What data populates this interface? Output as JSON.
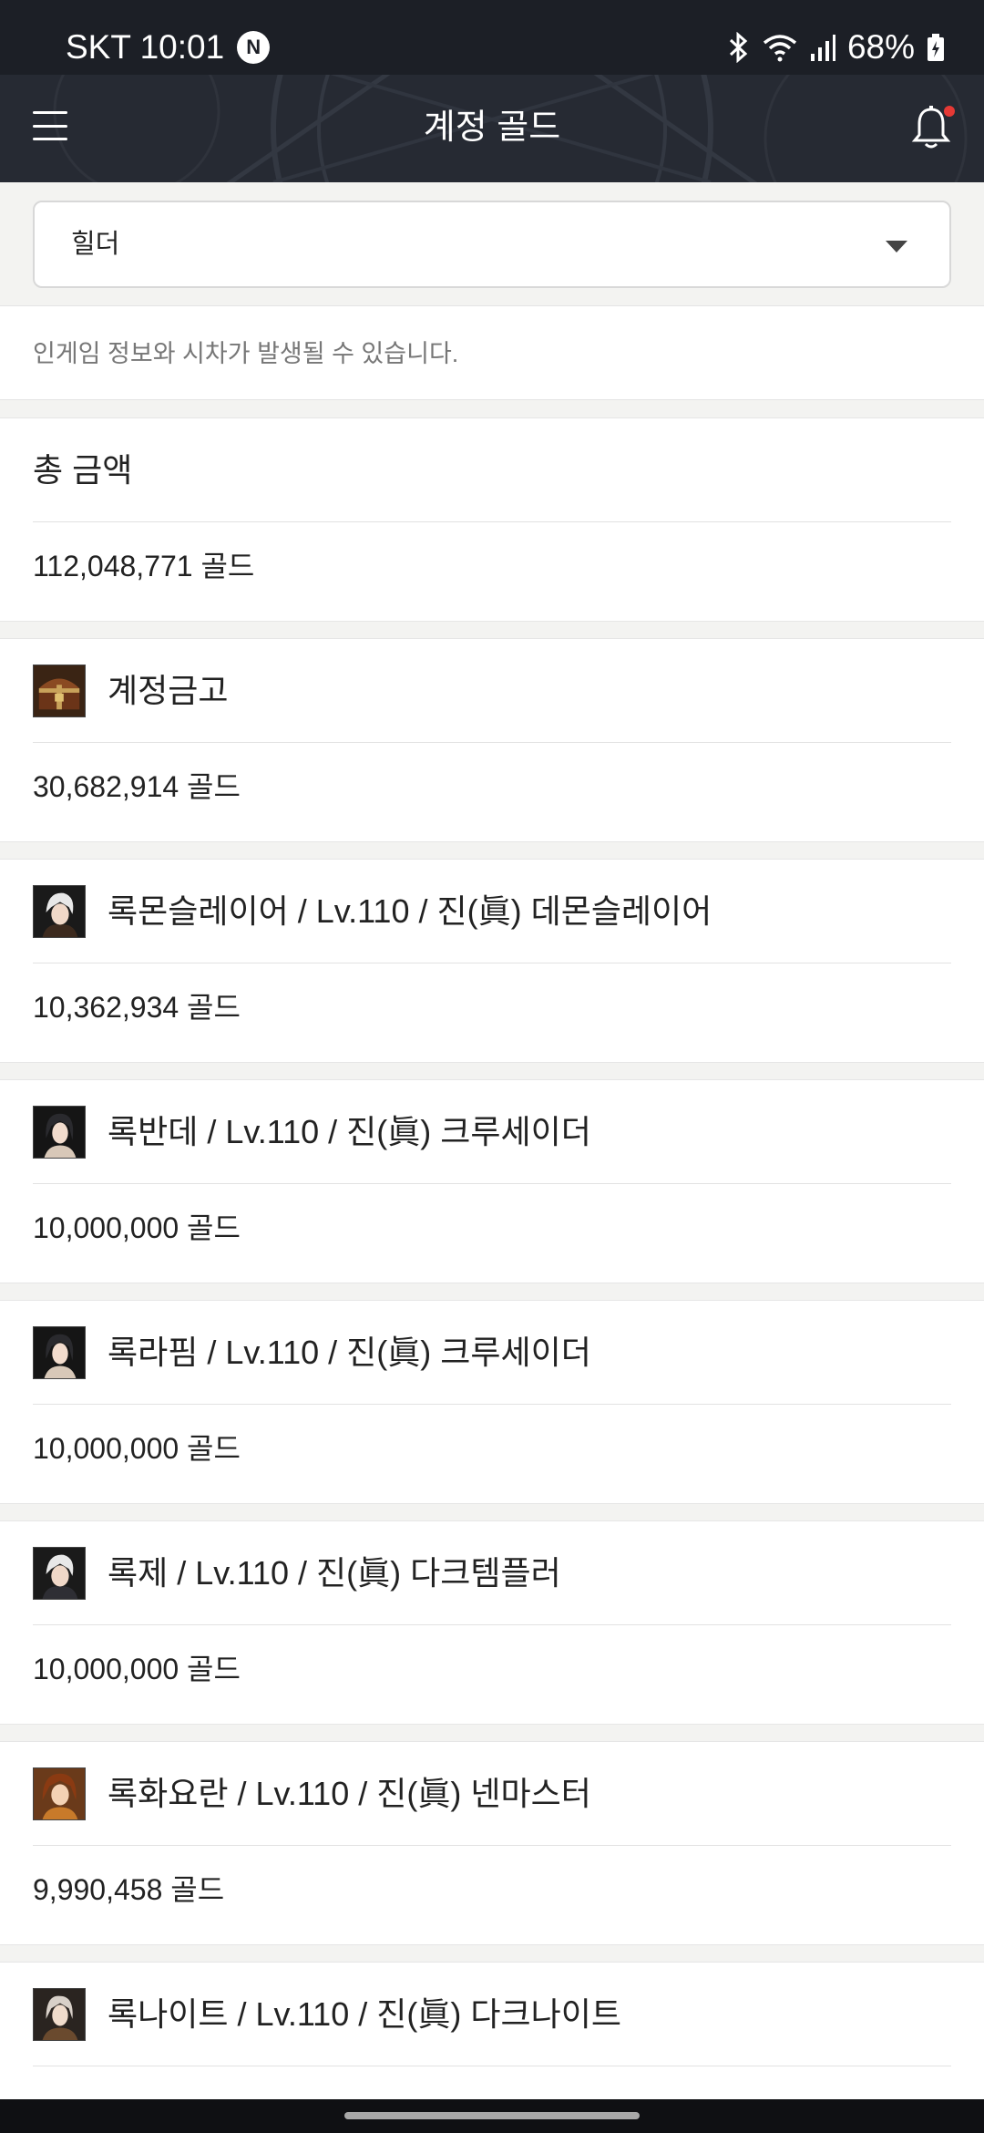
{
  "status_bar": {
    "carrier_time": "SKT 10:01",
    "n_badge": "N",
    "battery": "68%"
  },
  "header": {
    "title": "계정 골드",
    "menu_icon": "hamburger-icon",
    "bell_icon": "bell-icon"
  },
  "selector": {
    "value": "힐더",
    "caret_icon": "caret-down-icon"
  },
  "notice": "인게임 정보와 시차가 발생될 수 있습니다.",
  "total": {
    "label": "총 금액",
    "value": "112,048,771 골드"
  },
  "vault": {
    "label": "계정금고",
    "value": "30,682,914 골드"
  },
  "characters": [
    {
      "name": "록몬슬레이어 / Lv.110 / 진(眞) 데몬슬레이어",
      "gold": "10,362,934 골드"
    },
    {
      "name": "록반데 / Lv.110 / 진(眞) 크루세이더",
      "gold": "10,000,000 골드"
    },
    {
      "name": "록라핌 / Lv.110 / 진(眞) 크루세이더",
      "gold": "10,000,000 골드"
    },
    {
      "name": "록제 / Lv.110 / 진(眞) 다크템플러",
      "gold": "10,000,000 골드"
    },
    {
      "name": "록화요란 / Lv.110 / 진(眞) 넨마스터",
      "gold": "9,990,458 골드"
    },
    {
      "name": "록나이트 / Lv.110 / 진(眞) 다크나이트",
      "gold": ""
    }
  ],
  "colors": {
    "header_bg": "#262a33",
    "status_bg": "#1c1f26",
    "notification_dot": "#e53935",
    "page_bg": "#f3f3f1"
  }
}
